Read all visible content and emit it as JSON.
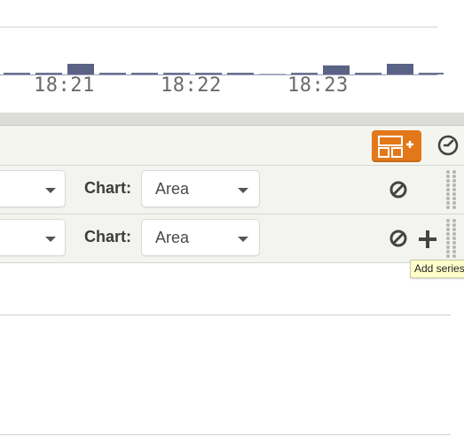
{
  "timeline": {
    "ticks": [
      {
        "label": "18:21"
      },
      {
        "label": "18:22"
      },
      {
        "label": "18:23"
      }
    ],
    "bar_color": "#5a6385",
    "bars": [
      0.15,
      0.15,
      1.0,
      0.15,
      0.15,
      0.15,
      0.15,
      0.15,
      0.0,
      0.15,
      0.85,
      0.15,
      1.0,
      0.15
    ]
  },
  "toolbar": {
    "add_panel_icon": "add-panel-icon",
    "clock_icon": "clock-icon",
    "accent_color": "#e3781a"
  },
  "series": [
    {
      "metric_value": "",
      "chart_label": "Chart:",
      "chart_type": "Area",
      "has_add": false
    },
    {
      "metric_value": "",
      "chart_label": "Chart:",
      "chart_type": "Area",
      "has_add": true
    }
  ],
  "tooltip": {
    "text": "Add series"
  }
}
